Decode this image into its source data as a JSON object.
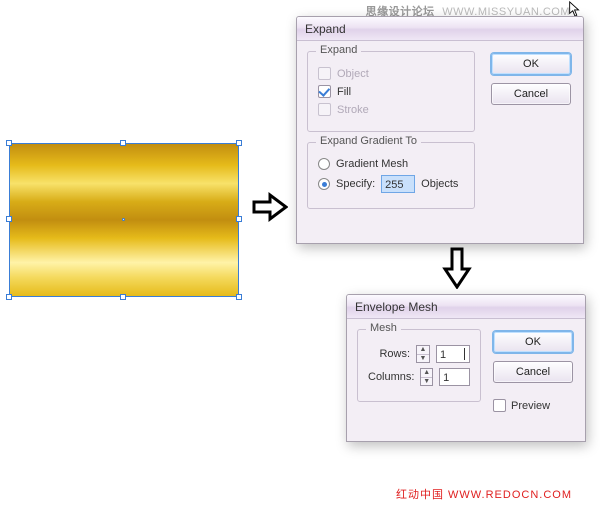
{
  "watermark": {
    "top_cn": "思缘设计论坛",
    "top_url": "WWW.MISSYUAN.COM",
    "bottom": "红动中国  WWW.REDOCN.COM"
  },
  "expand": {
    "title": "Expand",
    "group1": "Expand",
    "object": "Object",
    "fill": "Fill",
    "stroke": "Stroke",
    "group2": "Expand Gradient To",
    "gradient_mesh": "Gradient Mesh",
    "specify": "Specify:",
    "specify_value": "255",
    "objects_suffix": "Objects",
    "ok": "OK",
    "cancel": "Cancel"
  },
  "mesh": {
    "title": "Envelope Mesh",
    "group": "Mesh",
    "rows_label": "Rows:",
    "rows_value": "1",
    "cols_label": "Columns:",
    "cols_value": "1",
    "ok": "OK",
    "cancel": "Cancel",
    "preview": "Preview"
  }
}
